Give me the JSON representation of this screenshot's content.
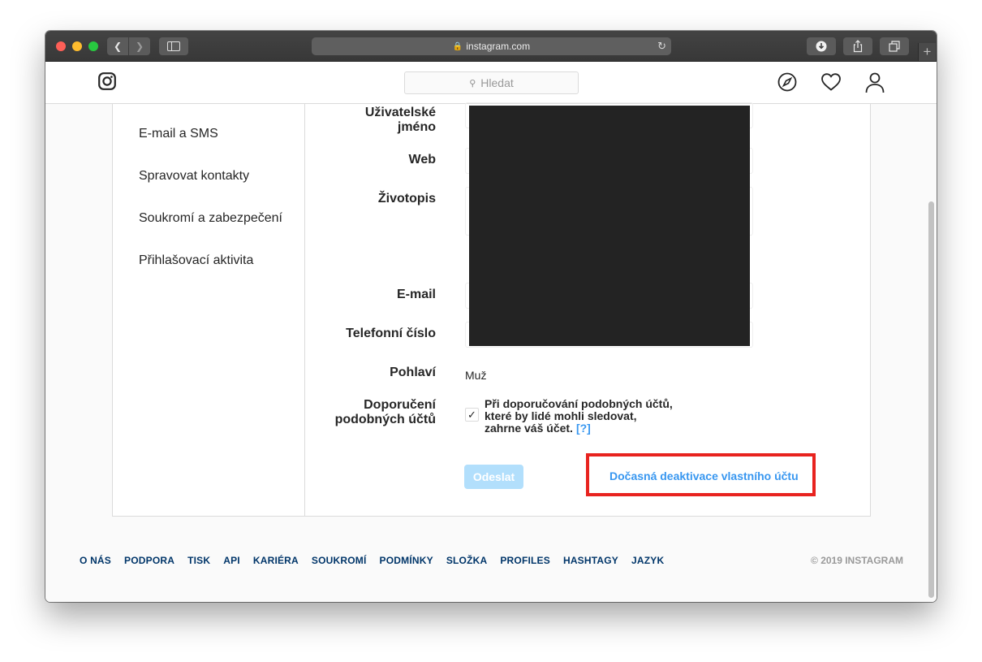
{
  "browser": {
    "url": "instagram.com"
  },
  "header": {
    "search_placeholder": "Hledat"
  },
  "sidebar": {
    "items": [
      {
        "label": "E-mail a SMS"
      },
      {
        "label": "Spravovat kontakty"
      },
      {
        "label": "Soukromí a zabezpečení"
      },
      {
        "label": "Přihlašovací aktivita"
      }
    ]
  },
  "form": {
    "labels": {
      "username_line1": "Uživatelské",
      "username_line2": "jméno",
      "web": "Web",
      "bio": "Životopis",
      "email": "E-mail",
      "phone": "Telefonní číslo",
      "gender": "Pohlaví",
      "suggest_line1": "Doporučení",
      "suggest_line2": "podobných účtů"
    },
    "gender_value": "Muž",
    "suggest_checked": true,
    "suggest_text_line1": "Při doporučování podobných účtů,",
    "suggest_text_line2": "které by lidé mohli sledovat,",
    "suggest_text_line3": "zahrne váš účet.",
    "help_link": "[?]",
    "submit_label": "Odeslat",
    "deactivate_label": "Dočasná deaktivace vlastního účtu"
  },
  "footer": {
    "links": [
      "O NÁS",
      "PODPORA",
      "TISK",
      "API",
      "KARIÉRA",
      "SOUKROMÍ",
      "PODMÍNKY",
      "SLOŽKA",
      "PROFILES",
      "HASHTAGY",
      "JAZYK"
    ],
    "copyright": "© 2019 INSTAGRAM"
  },
  "colors": {
    "accent": "#3897f0",
    "highlight": "#e8231f",
    "submit_disabled": "#b2dffc"
  }
}
